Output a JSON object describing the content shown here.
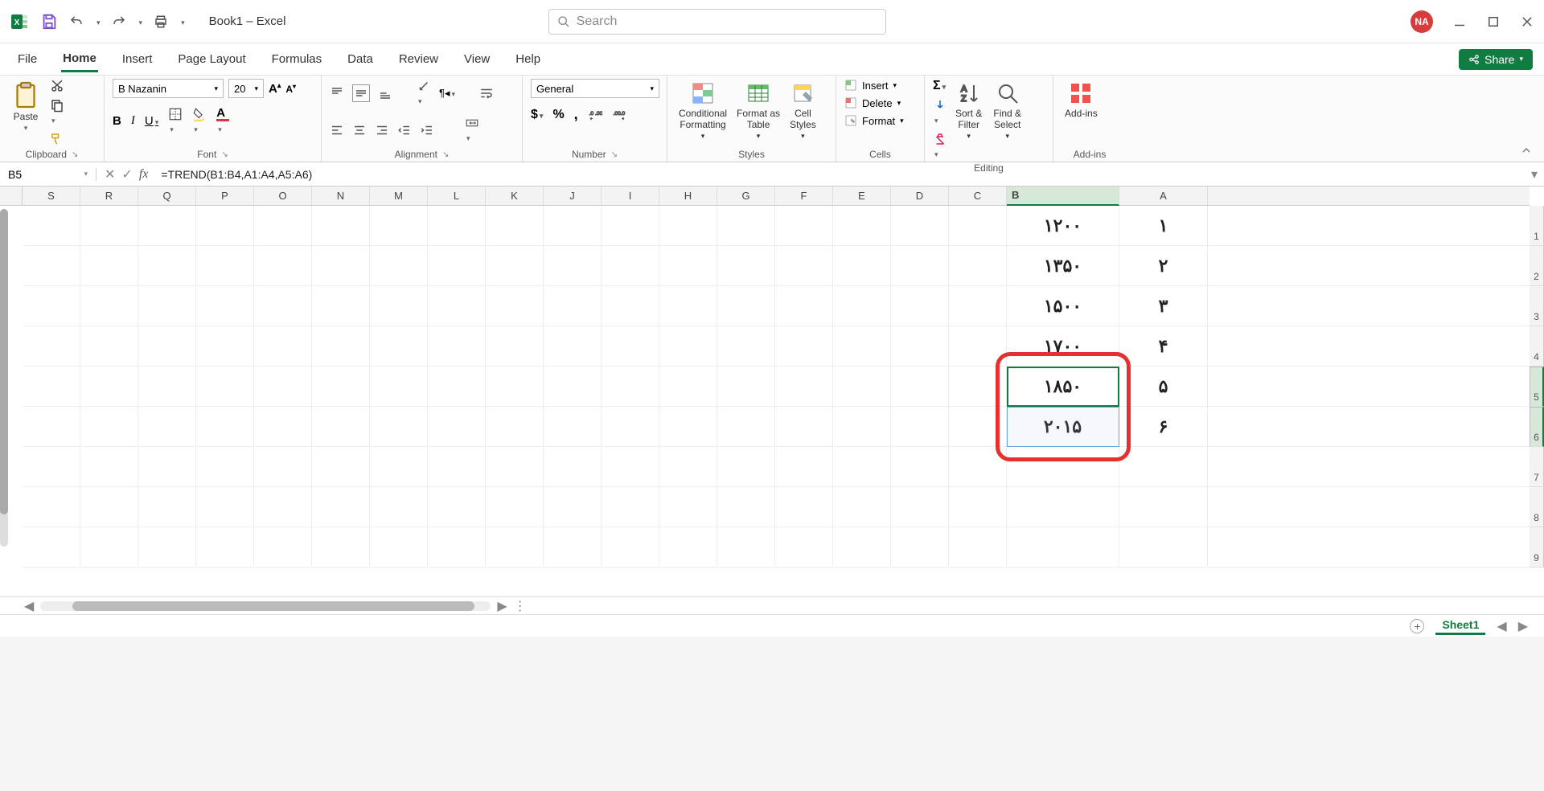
{
  "title": "Book1 – Excel",
  "search_placeholder": "Search",
  "user_initials": "NA",
  "menu": {
    "file": "File",
    "home": "Home",
    "insert": "Insert",
    "page_layout": "Page Layout",
    "formulas": "Formulas",
    "data": "Data",
    "review": "Review",
    "view": "View",
    "help": "Help",
    "share": "Share"
  },
  "ribbon": {
    "clipboard": {
      "label": "Clipboard",
      "paste": "Paste"
    },
    "font": {
      "label": "Font",
      "name": "B Nazanin",
      "size": "20"
    },
    "alignment": {
      "label": "Alignment"
    },
    "number": {
      "label": "Number",
      "format": "General"
    },
    "styles": {
      "label": "Styles",
      "conditional": "Conditional\nFormatting",
      "table": "Format as\nTable",
      "cell": "Cell\nStyles"
    },
    "cells": {
      "label": "Cells",
      "insert": "Insert",
      "delete": "Delete",
      "format": "Format"
    },
    "editing": {
      "label": "Editing",
      "sort": "Sort &\nFilter",
      "find": "Find &\nSelect"
    },
    "addins": {
      "label": "Add-ins",
      "btn": "Add-ins"
    }
  },
  "namebox": "B5",
  "formula": "=TREND(B1:B4,A1:A4,A5:A6)",
  "columns": [
    "S",
    "R",
    "Q",
    "P",
    "O",
    "N",
    "M",
    "L",
    "K",
    "J",
    "I",
    "H",
    "G",
    "F",
    "E",
    "D",
    "C",
    "B",
    "A"
  ],
  "rows": [
    "1",
    "2",
    "3",
    "4",
    "5",
    "6",
    "7",
    "8",
    "9"
  ],
  "data": {
    "A": [
      "۱",
      "۲",
      "۳",
      "۴",
      "۵",
      "۶",
      "",
      "",
      ""
    ],
    "B": [
      "۱۲۰۰",
      "۱۳۵۰",
      "۱۵۰۰",
      "۱۷۰۰",
      "۱۸۵۰",
      "۲۰۱۵",
      "",
      "",
      ""
    ]
  },
  "sheet": "Sheet1"
}
